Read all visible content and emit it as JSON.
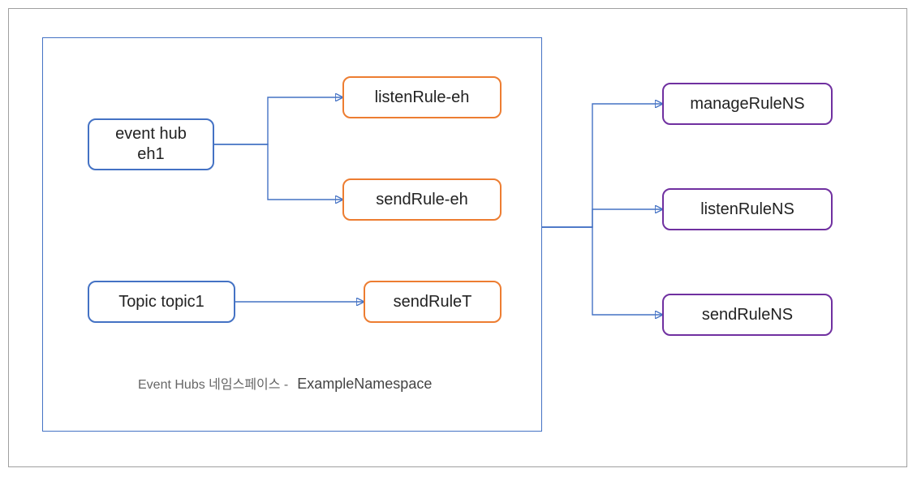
{
  "diagram": {
    "namespace_caption_lead": "Event Hubs 네임스페이스 -",
    "namespace_name": "ExampleNamespace",
    "nodes": {
      "event_hub": "event hub\neh1",
      "topic": "Topic topic1",
      "listen_rule_eh": "listenRule-eh",
      "send_rule_eh": "sendRule-eh",
      "send_rule_t": "sendRuleT",
      "manage_rule_ns": "manageRuleNS",
      "listen_rule_ns": "listenRuleNS",
      "send_rule_ns": "sendRuleNS"
    },
    "colors": {
      "outer_border": "#a0a0a0",
      "namespace_border": "#4472C4",
      "blue": "#4472C4",
      "orange": "#ED7D31",
      "purple": "#7030A0"
    },
    "edges": [
      {
        "from": "event_hub",
        "to": "listen_rule_eh"
      },
      {
        "from": "event_hub",
        "to": "send_rule_eh"
      },
      {
        "from": "topic",
        "to": "send_rule_t"
      },
      {
        "from": "namespace",
        "to": "manage_rule_ns"
      },
      {
        "from": "namespace",
        "to": "listen_rule_ns"
      },
      {
        "from": "namespace",
        "to": "send_rule_ns"
      }
    ]
  }
}
